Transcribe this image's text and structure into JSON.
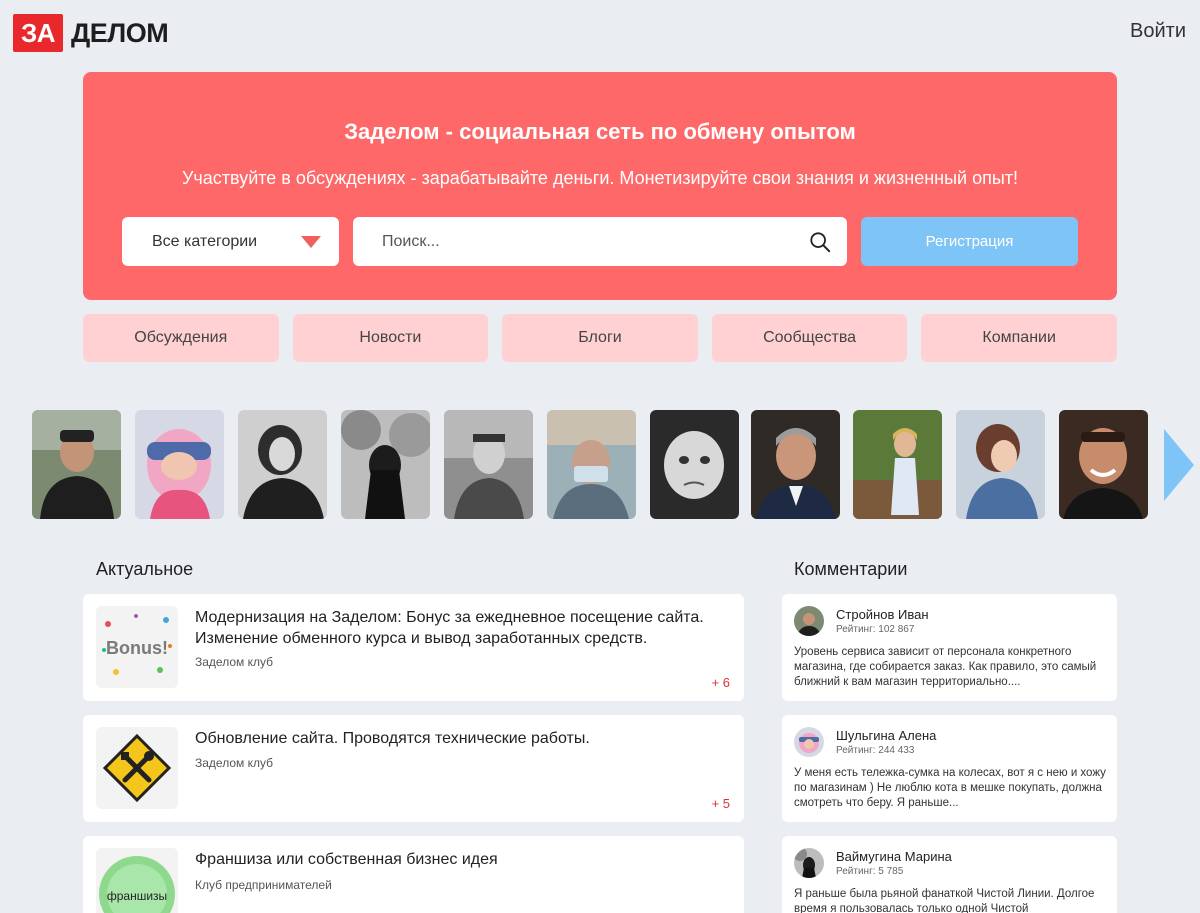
{
  "header": {
    "logo_box": "ЗА",
    "logo_text": "ДЕЛОМ",
    "login_label": "Войти"
  },
  "hero": {
    "title": "Заделом - социальная сеть по обмену опытом",
    "subtitle": "Участвуйте в обсуждениях - зарабатывайте деньги. Монетизируйте свои знания и жизненный опыт!",
    "category_select": "Все категории",
    "search_placeholder": "Поиск...",
    "register_label": "Регистрация"
  },
  "tabs": [
    "Обсуждения",
    "Новости",
    "Блоги",
    "Сообщества",
    "Компании"
  ],
  "sections": {
    "posts_title": "Актуальное",
    "comments_title": "Комментарии"
  },
  "posts": [
    {
      "title": "Модернизация на Заделом: Бонус за ежедневное посещение сайта. Изменение обменного курса и вывод заработанных средств.",
      "group": "Заделом клуб",
      "count": "+ 6",
      "thumb_label": "Bonus!"
    },
    {
      "title": "Обновление сайта. Проводятся технические работы.",
      "group": "Заделом клуб",
      "count": "+ 5"
    },
    {
      "title": "Франшиза или собственная бизнес идея",
      "group": "Клуб предпринимателей",
      "thumb_label": "франшизы"
    }
  ],
  "comments": [
    {
      "name": "Стройнов Иван",
      "rating": "Рейтинг: 102 867",
      "text": "Уровень сервиса зависит от персонала конкретного магазина, где собирается заказ. Как правило, это самый ближний к вам магазин территориально...."
    },
    {
      "name": "Шульгина Алена",
      "rating": "Рейтинг: 244 433",
      "text": "У меня есть тележка-сумка на колесах, вот я с нею и хожу по магазинам ) Не люблю кота в мешке покупать, должна смотреть что беру. Я раньше..."
    },
    {
      "name": "Ваймугина Марина",
      "rating": "Рейтинг: 5 785",
      "text": "Я раньше была рьяной фанаткой Чистой Линии. Долгое время я пользовалась только одной Чистой"
    }
  ],
  "colors": {
    "brand_red": "#e8282b",
    "hero_bg": "#fe6868",
    "tab_bg": "#ffd1d2",
    "accent_blue": "#7fc4f6",
    "page_bg": "#eaeef3"
  }
}
